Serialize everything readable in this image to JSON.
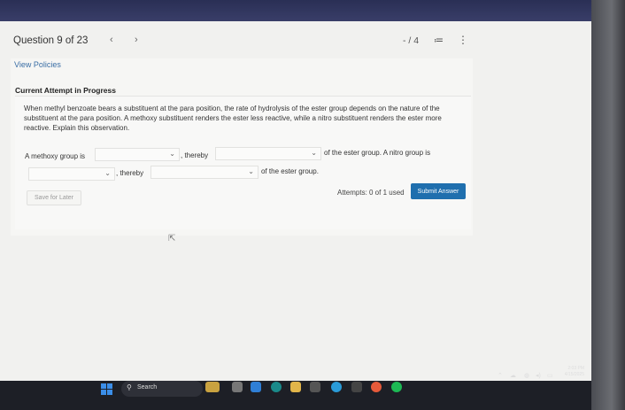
{
  "header": {
    "question_label": "Question 9 of 23",
    "prev": "‹",
    "next": "›",
    "page_counter": "- / 4",
    "list_icon": "≔",
    "more_icon": "⋮"
  },
  "policies_link": "View Policies",
  "attempt_heading": "Current Attempt in Progress",
  "question_text": "When methyl benzoate bears a substituent at the para position, the rate of hydrolysis of the ester group depends on the nature of the substituent at the para position. A methoxy substituent renders the ester less reactive, while a nitro substituent renders the ester more reactive. Explain this observation.",
  "sentence": {
    "part1": "A methoxy group is",
    "part2": ", thereby",
    "part3": "of the ester group. A nitro group is",
    "part4": ", thereby",
    "part5": "of the ester group."
  },
  "dropdowns": [
    "",
    "",
    "",
    ""
  ],
  "attempts_text": "Attempts: 0 of 1 used",
  "submit_label": "Submit Answer",
  "save_label": "Save for Later",
  "taskbar": {
    "search_label": "Search",
    "time": "2:03 PM",
    "date": "4/15/2025"
  },
  "colors": {
    "accent": "#1f6fae",
    "link": "#3a6ea5",
    "background": "#f1f1ef"
  },
  "icons": [
    "windows-icon",
    "search-icon",
    "chevron-down-icon"
  ]
}
